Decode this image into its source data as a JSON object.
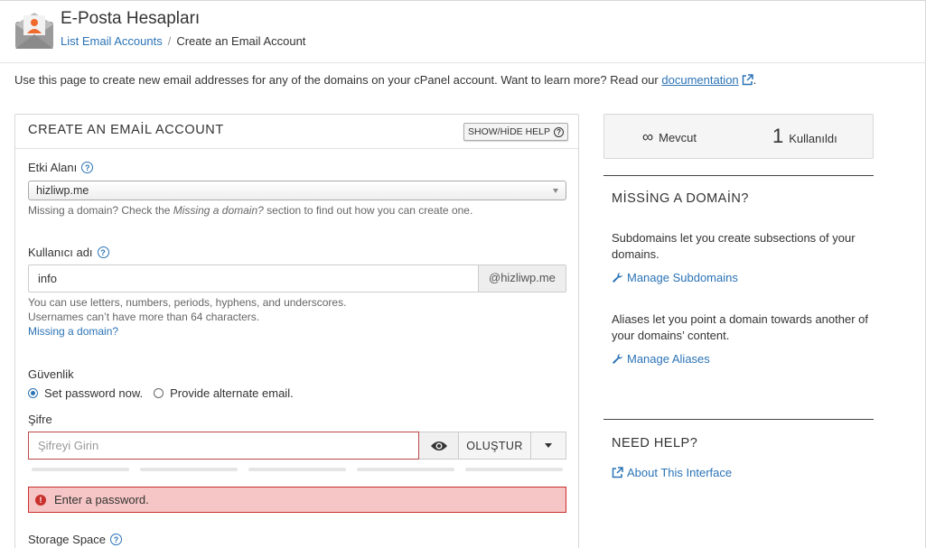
{
  "header": {
    "title": "E-Posta Hesapları",
    "breadcrumb": [
      "List Email Accounts",
      "/",
      "Create an Email Account"
    ]
  },
  "intro": {
    "text": "Use this page to create new email addresses for any of the domains on your cPanel account. Want to learn more? Read our",
    "link": "documentation",
    "tail": "."
  },
  "form": {
    "title": "CREATE AN EMAİL ACCOUNT",
    "help_toggle": "SHOW/HİDE HELP",
    "domain": {
      "label": "Etki Alanı",
      "value": "hizliwp.me",
      "hint_prefix": "Missing a domain? Check the ",
      "hint_em": "Missing a domain?",
      "hint_suffix": " section to find out how you can create one."
    },
    "username": {
      "label": "Kullanıcı adı",
      "value": "info",
      "suffix": "@hizliwp.me",
      "hint1": "You can use letters, numbers, periods, hyphens, and underscores.",
      "hint2": "Usernames can’t have more than 64 characters.",
      "missing_link": "Missing a domain?"
    },
    "security": {
      "label": "Güvenlik",
      "option_set": "Set password now.",
      "option_alt": "Provide alternate email."
    },
    "password": {
      "label": "Şifre",
      "placeholder": "Şifreyi Girin",
      "generate": "OLUŞTUR",
      "error": "Enter a password."
    },
    "storage": {
      "label": "Storage Space"
    }
  },
  "sidebar": {
    "stats": {
      "available_symbol": "∞",
      "available_label": "Mevcut",
      "used_count": "1",
      "used_label": "Kullanıldı"
    },
    "missing_domain": {
      "title": "MİSSİNG A DOMAİN?",
      "text1": "Subdomains let you create subsections of your domains.",
      "link1": "Manage Subdomains",
      "text2": "Aliases let you point a domain towards another of your domains’ content.",
      "link2": "Manage Aliases"
    },
    "need_help": {
      "title": "NEED HELP?",
      "link": "About This Interface"
    }
  },
  "colors": {
    "link": "#2b73b6",
    "error_bg": "#f5c6c5",
    "error_border": "#c9302c",
    "app_icon_orange": "#ef6a2c"
  }
}
